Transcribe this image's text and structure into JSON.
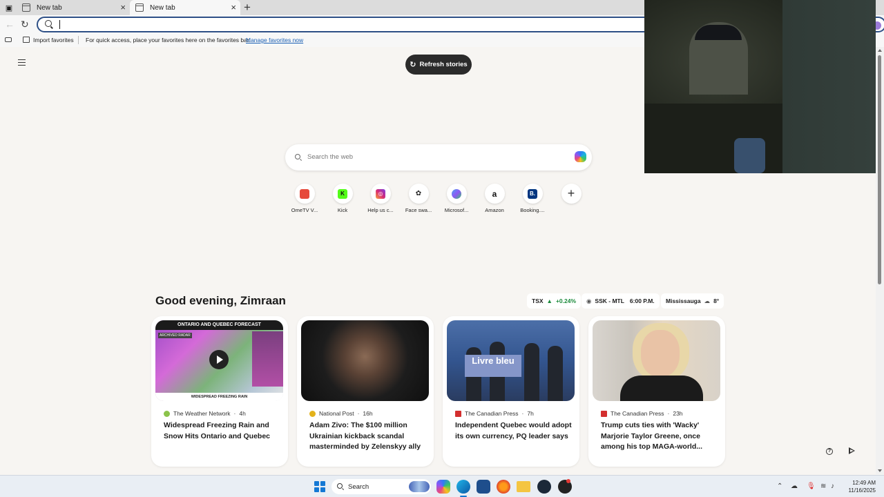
{
  "browser": {
    "tabs": [
      {
        "title": "New tab",
        "active": false
      },
      {
        "title": "New tab",
        "active": true
      }
    ],
    "address_value": "",
    "favorites_bar": {
      "import_label": "Import favorites",
      "message": "For quick access, place your favorites here on the favorites bar.",
      "link": "Manage favorites now"
    }
  },
  "page": {
    "refresh_label": "Refresh stories",
    "search_placeholder": "Search the web",
    "quick_links": [
      {
        "label": "OmeTV V...",
        "icon": "ometv-icon",
        "color": "#e64a3b"
      },
      {
        "label": "Kick",
        "icon": "kick-icon",
        "color": "#53fc18"
      },
      {
        "label": "Help us c...",
        "icon": "instagram-icon",
        "color": "#d62976"
      },
      {
        "label": "Face swa...",
        "icon": "openai-icon",
        "color": "#222222"
      },
      {
        "label": "Microsof...",
        "icon": "microsoft-copilot-icon",
        "color": "#6b7de0"
      },
      {
        "label": "Amazon",
        "icon": "amazon-icon",
        "color": "#111111"
      },
      {
        "label": "Booking....",
        "icon": "booking-icon",
        "color": "#003580"
      }
    ],
    "greeting": "Good evening, Zimraan",
    "widgets": {
      "tsx_label": "TSX",
      "tsx_change": "+0.24%",
      "game_label": "SSK - MTL",
      "game_time": "6:00 P.M.",
      "weather_city": "Mississauga",
      "weather_temp": "8°"
    },
    "stories": [
      {
        "source": "The Weather Network",
        "age": "4h",
        "headline": "Widespread Freezing Rain and Snow Hits Ontario and Quebec",
        "thumb_banner": "ONTARIO AND QUEBEC FORECAST",
        "thumb_tag": "ARCHIVED RADAR",
        "thumb_footer": "WIDESPREAD FREEZING RAIN"
      },
      {
        "source": "National Post",
        "age": "16h",
        "headline": "Adam Zivo: The $100 million Ukrainian kickback scandal masterminded by Zelenskyy ally"
      },
      {
        "source": "The Canadian Press",
        "age": "7h",
        "headline": "Independent Quebec would adopt its own currency, PQ leader says",
        "thumb_podium": "Livre bleu"
      },
      {
        "source": "The Canadian Press",
        "age": "23h",
        "headline": "Trump cuts ties with 'Wacky' Marjorie Taylor Greene, once among his top MAGA-world..."
      }
    ]
  },
  "taskbar": {
    "search_label": "Search",
    "time": "12:49 AM",
    "date": "11/16/2025"
  },
  "colors": {
    "accent": "#2d4f86",
    "positive": "#1a8a3a",
    "link": "#1a5fb4"
  }
}
